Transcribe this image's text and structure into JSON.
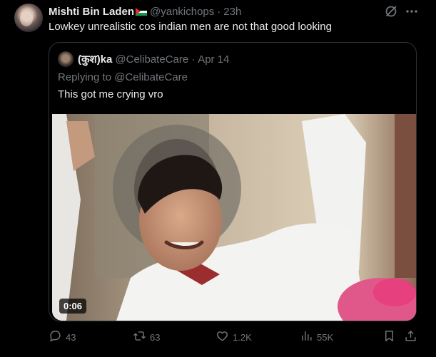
{
  "tweet": {
    "display_name": "Mishti Bin Laden",
    "handle": "@yankichops",
    "separator": "·",
    "time": "23h",
    "text": "Lowkey unrealistic cos indian men are not that good looking"
  },
  "quote": {
    "display_name": "(कुश)ka",
    "handle": "@CelibateCare",
    "separator": "·",
    "time": "Apr 14",
    "replying_prefix": "Replying to",
    "replying_handle": "@CelibateCare",
    "text": "This got me crying vro",
    "video_duration": "0:06"
  },
  "actions": {
    "replies": "43",
    "reposts": "63",
    "likes": "1.2K",
    "views": "55K"
  },
  "icons": [
    "grok-icon",
    "more-icon",
    "reply-icon",
    "repost-icon",
    "like-icon",
    "views-icon",
    "bookmark-icon",
    "share-icon"
  ],
  "colors": {
    "background": "#000000",
    "primary_text": "#e7e9ea",
    "secondary_text": "#71767b",
    "border": "#2f3336"
  }
}
